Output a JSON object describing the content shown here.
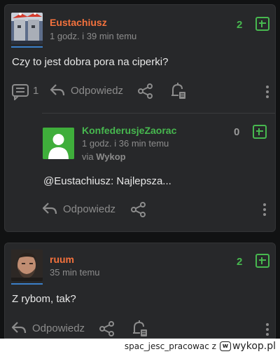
{
  "comments": [
    {
      "author": "Eustachiusz",
      "time": "1 godz. i 39 min temu",
      "text": "Czy to jest dobra pora na ciperki?",
      "votes": "2",
      "reply_count": "1",
      "reply_label": "Odpowiedz"
    },
    {
      "author": "ruum",
      "time": "35 min temu",
      "text": "Z rybom, tak?",
      "votes": "2",
      "reply_label": "Odpowiedz"
    }
  ],
  "reply": {
    "author": "KonfederusjeZaorac",
    "time": "1 godz. i 36 min temu",
    "via_prefix": "via",
    "via_source": "Wykop",
    "text": "@Eustachiusz: Najlepsza...",
    "votes": "0",
    "reply_label": "Odpowiedz"
  },
  "footer": {
    "text": "spac_jesc_pracowac z",
    "logo_text": "wykop.pl",
    "logo_box": "w"
  },
  "colors": {
    "background": "#111213",
    "card": "#27282a",
    "author_orange": "#f5723d",
    "author_green": "#47b84f",
    "vote_green": "#47b84f",
    "muted": "#8c8c8c",
    "accent_blue": "#3b7fc8"
  },
  "icons": [
    "comments-icon",
    "reply-arrow-icon",
    "share-icon",
    "notify-bell-icon",
    "more-vertical-icon",
    "plus-vote-icon",
    "default-avatar-icon"
  ]
}
